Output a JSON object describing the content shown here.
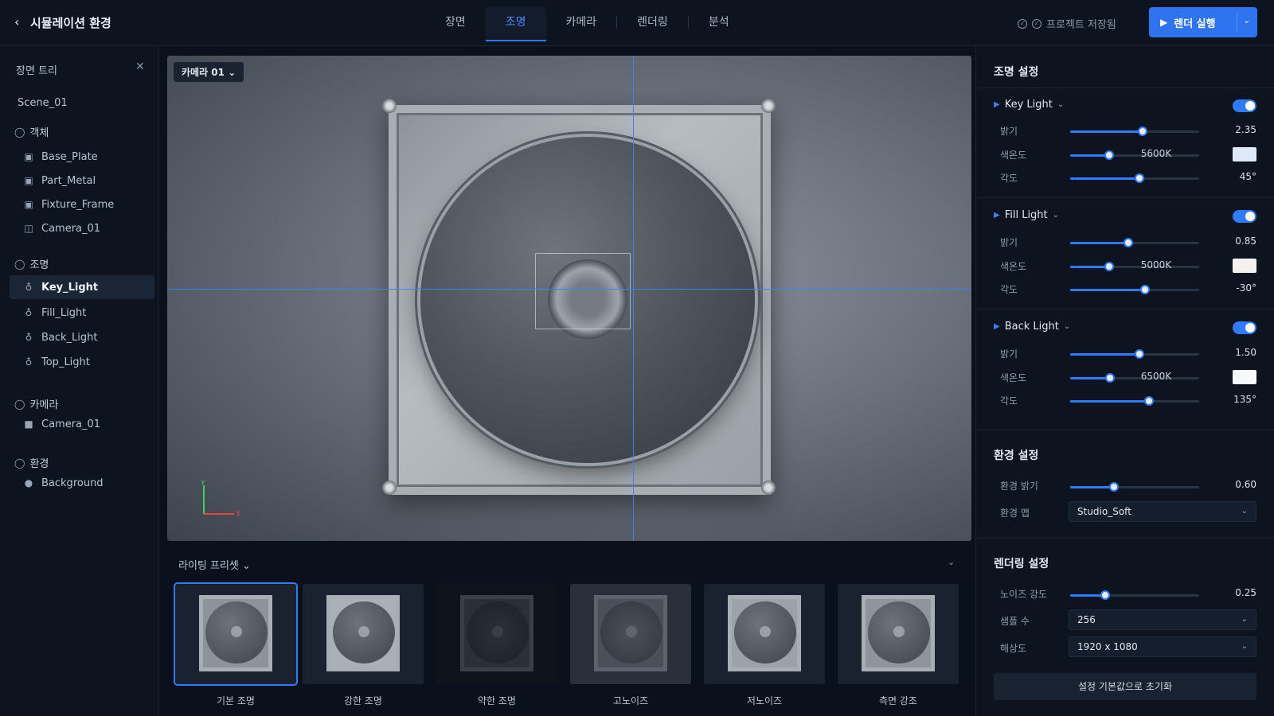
{
  "header": {
    "back_icon": "chevron-left-icon",
    "title": "시뮬레이션 환경",
    "tabs": [
      {
        "label": "장면",
        "active": false
      },
      {
        "label": "조명",
        "active": true
      },
      {
        "label": "카메라",
        "active": false
      },
      {
        "label": "렌더링",
        "active": false
      },
      {
        "label": "분석",
        "active": false
      }
    ],
    "saved_status": "프로젝트 저장됨",
    "render_button": "렌더 실행"
  },
  "scene_tree": {
    "title": "장면 트리",
    "scene_name": "Scene_01",
    "groups": [
      {
        "label": "객체",
        "items": [
          "Base_Plate",
          "Part_Metal",
          "Fixture_Frame",
          "Camera_01"
        ]
      },
      {
        "label": "조명",
        "items": [
          "Key_Light",
          "Fill_Light",
          "Back_Light",
          "Top_Light"
        ]
      },
      {
        "label": "카메라",
        "items": [
          "Camera_01"
        ]
      },
      {
        "label": "환경",
        "items": [
          "Background"
        ]
      }
    ],
    "selected": "Key_Light"
  },
  "viewport": {
    "camera_select": "카메라 01",
    "axis_x": "X",
    "axis_y": "Y"
  },
  "presets": {
    "title": "라이팅 프리셋",
    "items": [
      {
        "label": "기본 조명",
        "selected": true
      },
      {
        "label": "강한 조명",
        "selected": false
      },
      {
        "label": "약한 조명",
        "selected": false
      },
      {
        "label": "고노이즈",
        "selected": false
      },
      {
        "label": "저노이즈",
        "selected": false
      },
      {
        "label": "측면 강조",
        "selected": false
      }
    ]
  },
  "lighting": {
    "title": "조명 설정",
    "lights": [
      {
        "name": "Key Light",
        "enabled": true,
        "brightness_label": "밝기",
        "brightness_value": "2.35",
        "brightness_fraction": 0.56,
        "temp_label": "색온도",
        "temp_value": "5600K",
        "temp_fraction": 0.3,
        "temp_color": "#dfe8f7",
        "angle_label": "각도",
        "angle_value": "45°",
        "angle_fraction": 0.54
      },
      {
        "name": "Fill Light",
        "enabled": true,
        "brightness_label": "밝기",
        "brightness_value": "0.85",
        "brightness_fraction": 0.45,
        "temp_label": "색온도",
        "temp_value": "5000K",
        "temp_fraction": 0.3,
        "temp_color": "#f4f2ee",
        "angle_label": "각도",
        "angle_value": "-30°",
        "angle_fraction": 0.58
      },
      {
        "name": "Back Light",
        "enabled": true,
        "brightness_label": "밝기",
        "brightness_value": "1.50",
        "brightness_fraction": 0.54,
        "temp_label": "색온도",
        "temp_value": "6500K",
        "temp_fraction": 0.31,
        "temp_color": "#f7f8fa",
        "angle_label": "각도",
        "angle_value": "135°",
        "angle_fraction": 0.61
      }
    ]
  },
  "environment": {
    "title": "환경 설정",
    "brightness_label": "환경 밝기",
    "brightness_value": "0.60",
    "brightness_fraction": 0.34,
    "map_label": "환경 맵",
    "map_value": "Studio_Soft"
  },
  "rendering": {
    "title": "렌더링 설정",
    "noise_label": "노이즈 강도",
    "noise_value": "0.25",
    "noise_fraction": 0.27,
    "samples_label": "샘플 수",
    "samples_value": "256",
    "resolution_label": "해상도",
    "resolution_value": "1920 x 1080",
    "reset_button": "설정 기본값으로 초기화"
  },
  "colors": {
    "accent": "#2f7bff",
    "background": "#0b111c",
    "panel": "#0d1420"
  }
}
